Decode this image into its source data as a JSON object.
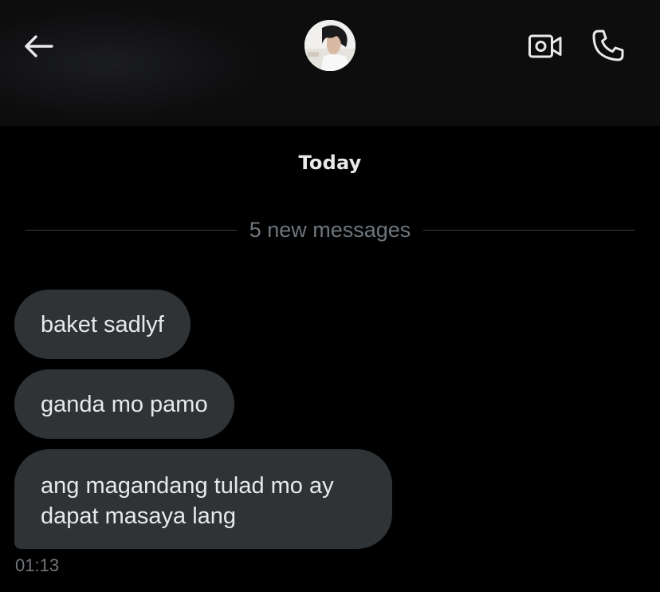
{
  "header": {
    "back_icon": "arrow-left-icon",
    "avatar_icon": "profile-avatar",
    "video_icon": "video-camera-icon",
    "call_icon": "phone-icon"
  },
  "conversation": {
    "date_label": "Today",
    "new_messages_label": "5 new messages",
    "messages": [
      {
        "text": "baket sadlyf"
      },
      {
        "text": "ganda mo pamo"
      },
      {
        "text": "ang magandang tulad mo ay dapat masaya lang"
      }
    ],
    "timestamp": "01:13"
  },
  "colors": {
    "background": "#000000",
    "header_background": "#0d0d0e",
    "bubble": "#2f3336",
    "text": "#e7e9ea",
    "muted_text": "#6e767d",
    "divider": "#3a3d41"
  }
}
